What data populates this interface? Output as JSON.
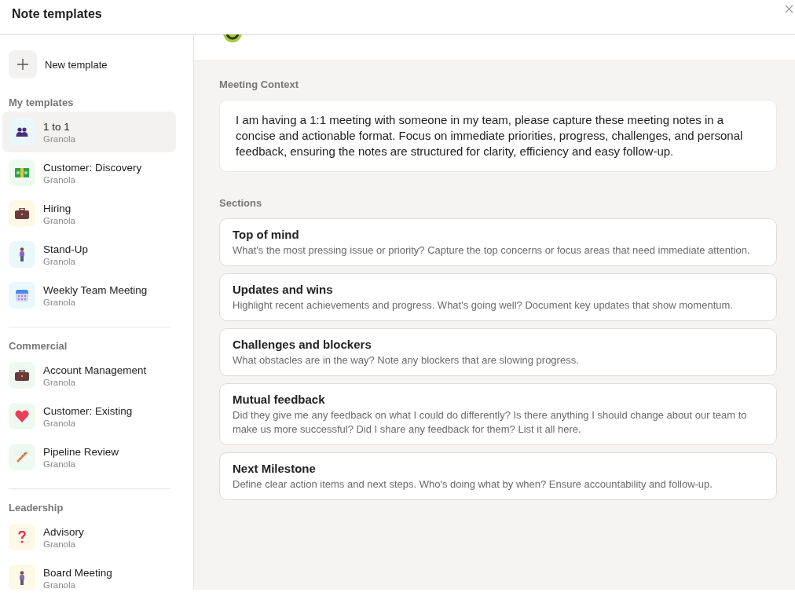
{
  "window": {
    "title": "Note templates"
  },
  "sidebar": {
    "new_button": {
      "label": "New template"
    },
    "groups": [
      {
        "title": "My templates",
        "items": [
          {
            "name": "1 to 1",
            "author": "Granola",
            "kind": "people",
            "color": "#eaf8fb",
            "selected": true
          },
          {
            "name": "Customer: Discovery",
            "author": "Granola",
            "kind": "money",
            "color": "#eefaf1",
            "selected": false
          },
          {
            "name": "Hiring",
            "author": "Granola",
            "kind": "briefcase",
            "color": "#fdf9e6",
            "selected": false
          },
          {
            "name": "Stand-Up",
            "author": "Granola",
            "kind": "person",
            "color": "#eaf8fb",
            "selected": false
          },
          {
            "name": "Weekly Team Meeting",
            "author": "Granola",
            "kind": "calendar",
            "color": "#eaf8fb",
            "selected": false
          }
        ]
      },
      {
        "title": "Commercial",
        "items": [
          {
            "name": "Account Management",
            "author": "Granola",
            "kind": "briefcase",
            "color": "#eefaf1",
            "selected": false
          },
          {
            "name": "Customer: Existing",
            "author": "Granola",
            "kind": "heart",
            "color": "#eefaf1",
            "selected": false
          },
          {
            "name": "Pipeline Review",
            "author": "Granola",
            "kind": "ruler",
            "color": "#eefaf1",
            "selected": false
          }
        ]
      },
      {
        "title": "Leadership",
        "items": [
          {
            "name": "Advisory",
            "author": "Granola",
            "kind": "question",
            "color": "#fdf9e6",
            "selected": false
          },
          {
            "name": "Board Meeting",
            "author": "Granola",
            "kind": "person",
            "color": "#fdf9e6",
            "selected": false
          }
        ]
      }
    ]
  },
  "context": {
    "label": "Meeting Context",
    "text": "I am having a 1:1 meeting with someone in my team, please capture these meeting notes in a concise and actionable format. Focus on immediate priorities, progress, challenges, and personal feedback, ensuring the notes are structured for clarity, efficiency and easy follow-up."
  },
  "sections": {
    "label": "Sections",
    "items": [
      {
        "title": "Top of mind",
        "description": "What's the most pressing issue or priority? Capture the top concerns or focus areas that need immediate attention."
      },
      {
        "title": "Updates and wins",
        "description": "Highlight recent achievements and progress. What's going well? Document key updates that show momentum."
      },
      {
        "title": "Challenges and blockers",
        "description": "What obstacles are in the way? Note any blockers that are slowing progress."
      },
      {
        "title": "Mutual feedback",
        "description": "Did they give me any feedback on what I could do differently? Is there anything I should change about our team to make us more successful? Did I share any feedback for them? List it all here."
      },
      {
        "title": "Next Milestone",
        "description": "Define clear action items and next steps. Who's doing what by when? Ensure accountability and follow-up."
      }
    ]
  }
}
